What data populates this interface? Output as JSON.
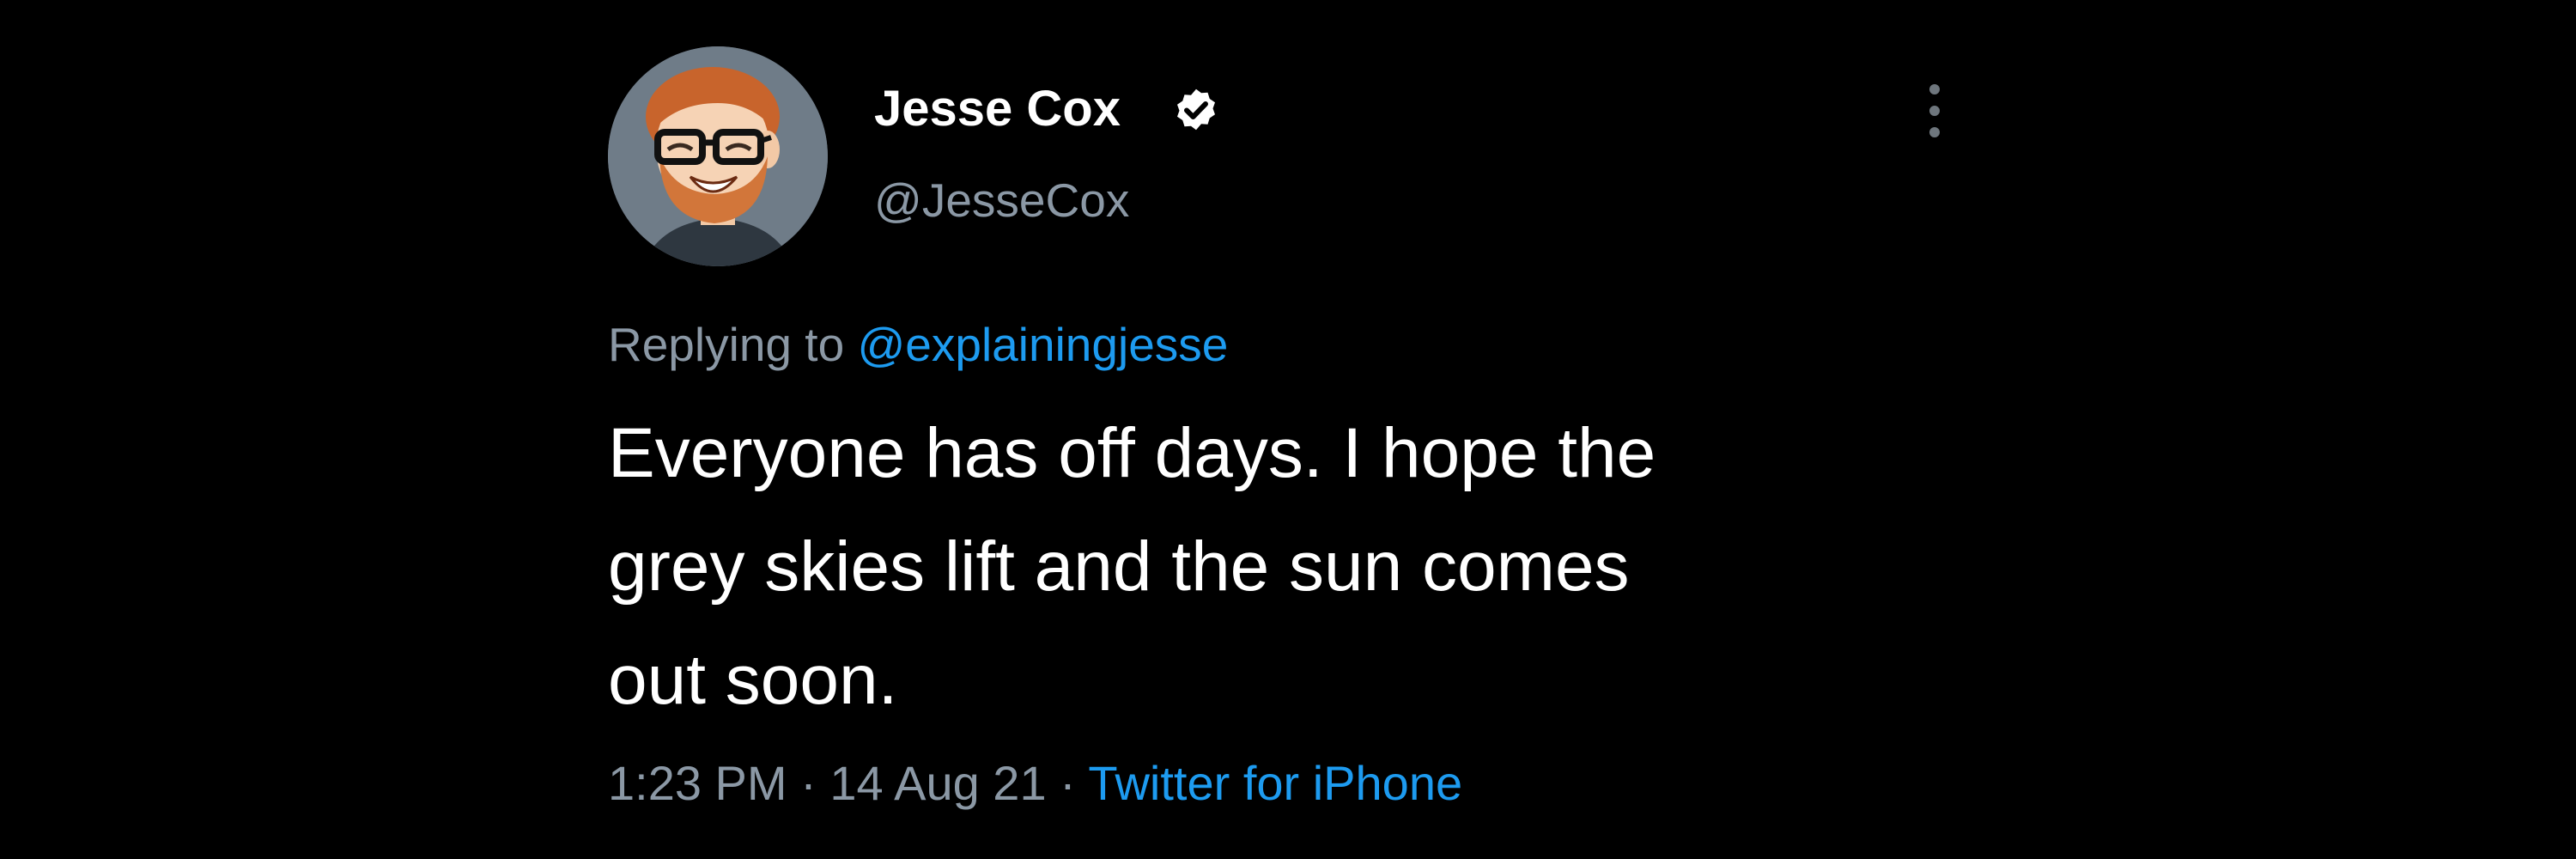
{
  "author": {
    "display_name": "Jesse Cox",
    "handle": "@JesseCox",
    "verified_icon": "verified-badge-icon",
    "avatar_icon": "cartoon-bearded-man-with-glasses-avatar"
  },
  "menu": {
    "icon": "vertical-ellipsis-icon"
  },
  "reply_context": {
    "prefix": "Replying to",
    "mention": "@explainingjesse"
  },
  "tweet": {
    "text_lines": [
      "Everyone has off days. I hope the",
      "grey skies lift and the sun comes",
      "out soon."
    ]
  },
  "meta": {
    "time": "1:23 PM",
    "separator": "·",
    "date": "14 Aug 21",
    "source": "Twitter for iPhone"
  },
  "colors": {
    "background": "#000000",
    "primary_text": "#ffffff",
    "secondary_text": "#8b98a5",
    "link": "#1d9bf0",
    "avatar_bg": "#6f7c88"
  }
}
